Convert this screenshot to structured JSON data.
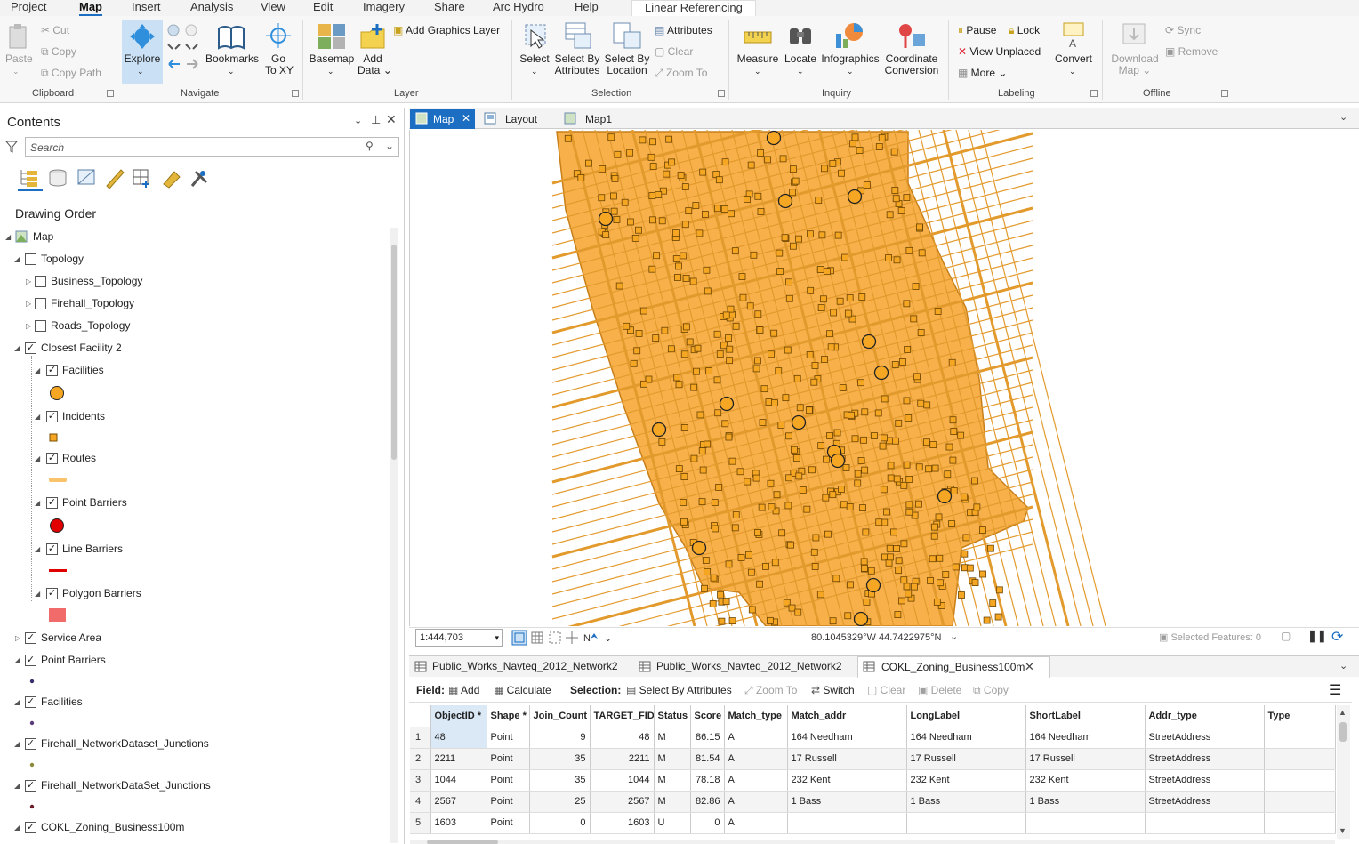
{
  "ribbon_tabs": [
    "Project",
    "Map",
    "Insert",
    "Analysis",
    "View",
    "Edit",
    "Imagery",
    "Share",
    "Arc Hydro",
    "Help",
    "Linear Referencing"
  ],
  "clipboard": {
    "paste": "Paste",
    "cut": "Cut",
    "copy": "Copy",
    "copy_path": "Copy Path",
    "label": "Clipboard"
  },
  "navigate": {
    "explore": "Explore",
    "bookmarks": "Bookmarks",
    "go_to": "Go",
    "go_to2": "To XY",
    "label": "Navigate"
  },
  "layer": {
    "basemap": "Basemap",
    "add": "Add",
    "data": "Data",
    "add_graphics": "Add Graphics Layer",
    "label": "Layer"
  },
  "selection": {
    "select": "Select",
    "by_attr1": "Select By",
    "by_attr2": "Attributes",
    "by_loc1": "Select By",
    "by_loc2": "Location",
    "attributes": "Attributes",
    "clear": "Clear",
    "zoom_to": "Zoom To",
    "label": "Selection"
  },
  "inquiry": {
    "measure": "Measure",
    "locate": "Locate",
    "infographics": "Infographics",
    "coord1": "Coordinate",
    "coord2": "Conversion",
    "label": "Inquiry"
  },
  "labeling": {
    "pause": "Pause",
    "lock": "Lock",
    "view_unplaced": "View Unplaced",
    "more": "More",
    "convert": "Convert",
    "label": "Labeling"
  },
  "offline": {
    "download1": "Download",
    "download2": "Map",
    "sync": "Sync",
    "remove": "Remove",
    "label": "Offline"
  },
  "contents": {
    "title": "Contents",
    "search_placeholder": "Search",
    "drawing_order": "Drawing Order",
    "layers": [
      {
        "name": "Map"
      },
      {
        "name": "Topology"
      },
      {
        "name": "Business_Topology"
      },
      {
        "name": "Firehall_Topology"
      },
      {
        "name": "Roads_Topology"
      },
      {
        "name": "Closest Facility 2"
      },
      {
        "name": "Facilities"
      },
      {
        "name": "Incidents"
      },
      {
        "name": "Routes"
      },
      {
        "name": "Point Barriers"
      },
      {
        "name": "Line Barriers"
      },
      {
        "name": "Polygon Barriers"
      },
      {
        "name": "Service Area"
      },
      {
        "name": "Point Barriers"
      },
      {
        "name": "Facilities"
      },
      {
        "name": "Firehall_NetworkDataset_Junctions"
      },
      {
        "name": "Firehall_NetworkDataSet_Junctions"
      },
      {
        "name": "COKL_Zoning_Business100m"
      }
    ]
  },
  "map_tabs": [
    "Map",
    "Layout",
    "Map1"
  ],
  "status": {
    "scale": "1:444,703",
    "coords": "80.1045329°W 44.7422975°N",
    "selected": "Selected Features: 0"
  },
  "table_tabs": [
    "Public_Works_Navteq_2012_Network2",
    "Public_Works_Navteq_2012_Network2",
    "COKL_Zoning_Business100m"
  ],
  "table_tools": {
    "field": "Field:",
    "add": "Add",
    "calculate": "Calculate",
    "selection": "Selection:",
    "select_by_attr": "Select By Attributes",
    "zoom_to": "Zoom To",
    "switch": "Switch",
    "clear": "Clear",
    "delete": "Delete",
    "copy": "Copy"
  },
  "table": {
    "columns": [
      "",
      "ObjectID *",
      "Shape *",
      "Join_Count",
      "TARGET_FID",
      "Status",
      "Score",
      "Match_type",
      "Match_addr",
      "LongLabel",
      "ShortLabel",
      "Addr_type",
      "Type"
    ],
    "rows": [
      [
        "1",
        "48",
        "Point",
        "9",
        "48",
        "M",
        "86.15",
        "A",
        "164 Needham",
        "164 Needham",
        "164 Needham",
        "StreetAddress",
        ""
      ],
      [
        "2",
        "2211",
        "Point",
        "35",
        "2211",
        "M",
        "81.54",
        "A",
        "17 Russell",
        "17 Russell",
        "17 Russell",
        "StreetAddress",
        ""
      ],
      [
        "3",
        "1044",
        "Point",
        "35",
        "1044",
        "M",
        "78.18",
        "A",
        "232 Kent",
        "232 Kent",
        "232 Kent",
        "StreetAddress",
        ""
      ],
      [
        "4",
        "2567",
        "Point",
        "25",
        "2567",
        "M",
        "82.86",
        "A",
        "1 Bass",
        "1 Bass",
        "1 Bass",
        "StreetAddress",
        ""
      ],
      [
        "5",
        "1603",
        "Point",
        "0",
        "1603",
        "U",
        "0",
        "A",
        "",
        "",
        "",
        "",
        ""
      ]
    ]
  },
  "colors": {
    "accent": "#1b6ec2",
    "facility": "#f5a623",
    "route": "#f9c36b",
    "barrier": "#e00000",
    "polygon_barrier": "#f26b6b",
    "map_fill": "#f7b04a"
  }
}
